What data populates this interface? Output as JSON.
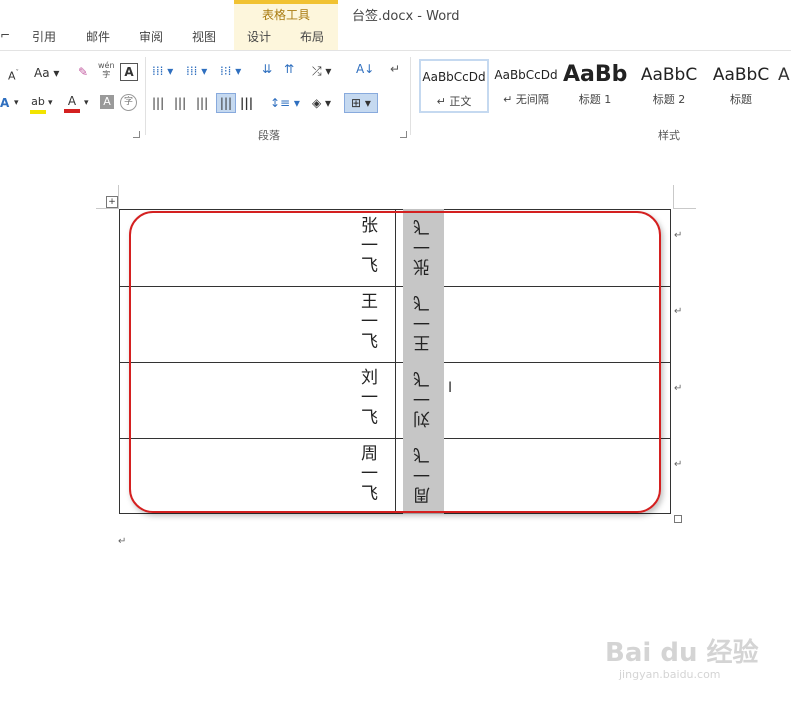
{
  "window": {
    "title": "台签.docx - Word"
  },
  "tabs": [
    {
      "label": "引用"
    },
    {
      "label": "邮件"
    },
    {
      "label": "审阅"
    },
    {
      "label": "视图"
    }
  ],
  "table_tools": {
    "title": "表格工具",
    "tabs": [
      {
        "label": "设计"
      },
      {
        "label": "布局"
      }
    ]
  },
  "ribbon": {
    "font": {
      "case_label": "Aa",
      "grow_label": "A",
      "phonetic_label": "wén",
      "border_label": "A",
      "highlight_label": "ab",
      "color_label": "A",
      "shade_label": "A",
      "circle_label": "字"
    },
    "paragraph": {
      "label": "段落"
    },
    "styles": {
      "label": "样式",
      "items": [
        {
          "sample": "AaBbCcDd",
          "name": "正文"
        },
        {
          "sample": "AaBbCcDd",
          "name": "无间隔"
        },
        {
          "sample": "AaBb",
          "name": "标题 1"
        },
        {
          "sample": "AaBbC",
          "name": "标题 2"
        },
        {
          "sample": "AaBbC",
          "name": "标题"
        }
      ]
    }
  },
  "table": {
    "rows": [
      {
        "left_name": "张一飞",
        "right_name": "张一飞"
      },
      {
        "left_name": "王一飞",
        "right_name": "王一飞"
      },
      {
        "left_name": "刘一飞",
        "right_name": "刘一飞"
      },
      {
        "left_name": "周一飞",
        "right_name": "周一飞"
      }
    ]
  },
  "marks": {
    "paragraph": "↵",
    "move": "+"
  },
  "watermark": {
    "brand": "Bai du 经验",
    "url": "jingyan.baidu.com"
  },
  "colors": {
    "context_accent": "#f1c232",
    "annotation": "#d42020",
    "selection": "#c6c6c6"
  }
}
